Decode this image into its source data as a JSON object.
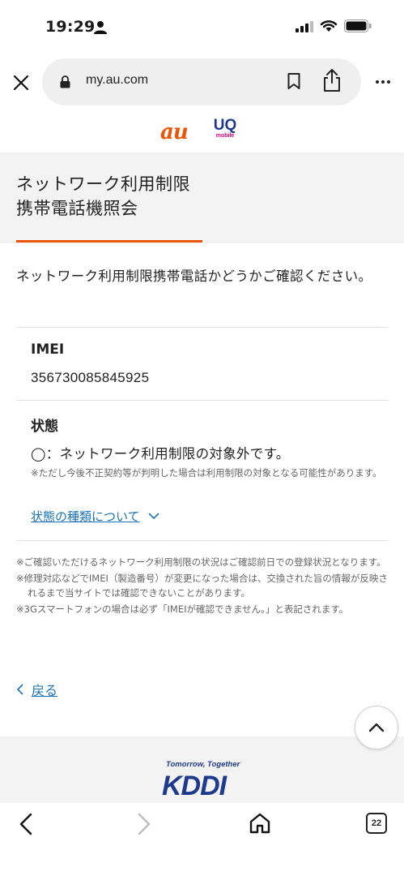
{
  "status_bar": {
    "time": "19:29"
  },
  "browser": {
    "url": "my.au.com",
    "tab_count": "22"
  },
  "brand": {
    "au": "au",
    "uq_main": "UQ",
    "uq_sub": "mobile"
  },
  "page": {
    "title_line1": "ネットワーク利用制限",
    "title_line2": "携帯電話機照会",
    "intro": "ネットワーク利用制限携帯電話かどうかご確認ください。"
  },
  "imei": {
    "label": "IMEI",
    "value": "356730085845925"
  },
  "status": {
    "label": "状態",
    "result": "◯：ネットワーク利用制限の対象外です。",
    "note": "※ただし今後不正契約等が判明した場合は利用制限の対象となる可能性があります。",
    "link": "状態の種類について"
  },
  "notes": [
    "※ご確認いただけるネットワーク利用制限の状況はご確認前日での登録状況となります。",
    "※修理対応などでIMEI（製造番号）が変更になった場合は、交換された旨の情報が反映されるまで当サイトでは確認できないことがあります。",
    "※3Gスマートフォンの場合は必ず「IMEIが確認できません。」と表記されます。"
  ],
  "back": {
    "label": "戻る"
  },
  "footer": {
    "tagline": "Tomorrow, Together",
    "logo": "KDDI"
  },
  "colors": {
    "accent": "#eb5505",
    "link": "#1a73b8",
    "band": "#f3f3f3",
    "kddi": "#1e3a8f",
    "uq_pink": "#e6007e"
  }
}
